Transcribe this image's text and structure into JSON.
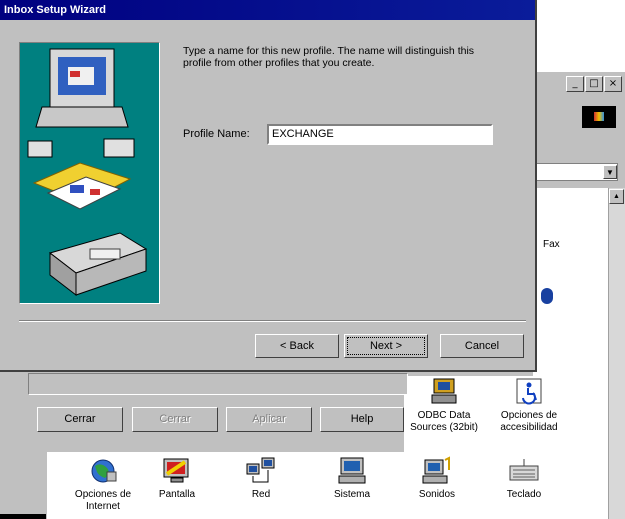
{
  "wizard": {
    "title": "Inbox Setup Wizard",
    "instructions": "Type a name for this new profile. The name will distinguish this profile from other profiles that you create.",
    "profile_name_label": "Profile Name:",
    "profile_name_value": "EXCHANGE",
    "buttons": {
      "back": "< Back",
      "next": "Next >",
      "cancel": "Cancel"
    }
  },
  "background_window": {
    "title_controls": [
      "_",
      "□",
      "×"
    ],
    "fax_label": "Fax",
    "buttons": {
      "cerrar": "Cerrar",
      "disabled_1": "Cerrar",
      "disabled_2": "Aplicar",
      "help": "Help"
    },
    "top_icons": [
      {
        "label": "ODBC Data Sources (32bit)",
        "icon": "odbc-icon"
      },
      {
        "label": "Opciones de accesibilidad",
        "icon": "accessibility-icon"
      }
    ],
    "bottom_icons": [
      {
        "label": "Opciones de Internet",
        "icon": "internet-options-icon"
      },
      {
        "label": "Pantalla",
        "icon": "display-icon"
      },
      {
        "label": "Red",
        "icon": "network-icon"
      },
      {
        "label": "Sistema",
        "icon": "system-icon"
      },
      {
        "label": "Sonidos",
        "icon": "sounds-icon"
      },
      {
        "label": "Teclado",
        "icon": "keyboard-icon"
      }
    ]
  },
  "colors": {
    "titlebar": "#000080",
    "dialog": "#c0c0c0",
    "illustration_bg": "#008080"
  }
}
